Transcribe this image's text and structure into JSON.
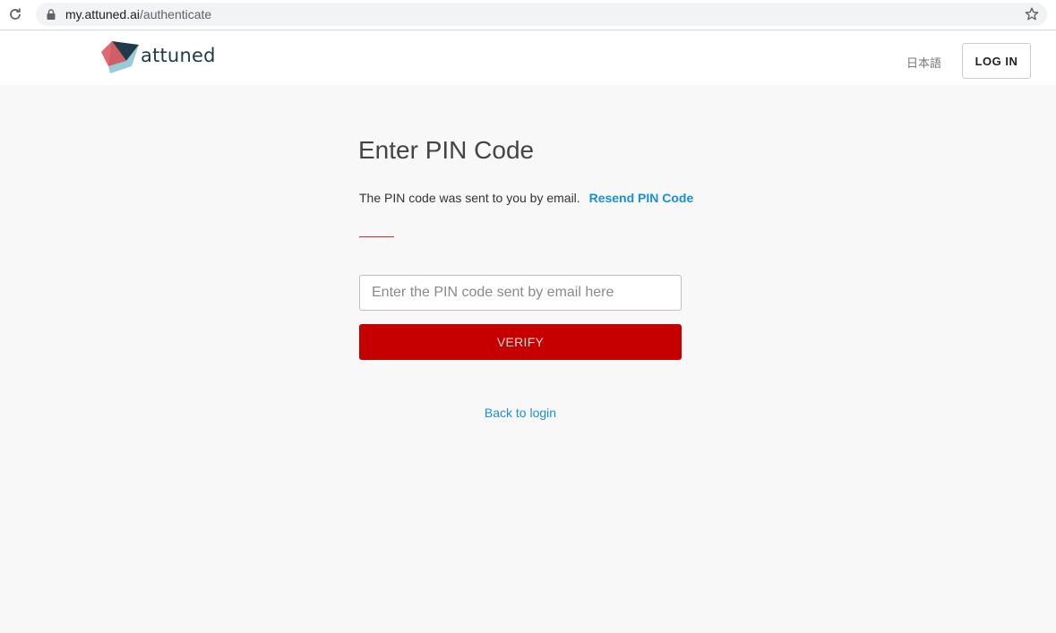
{
  "browser": {
    "url_host": "my.attuned.ai",
    "url_path": "/authenticate",
    "icons": [
      "reload-icon",
      "lock-icon",
      "star-icon"
    ]
  },
  "header": {
    "logo_text": "attuned",
    "language_link": "日本語",
    "login_label": "LOG IN"
  },
  "main": {
    "title": "Enter PIN Code",
    "info_text": "The PIN code was sent to you by email.",
    "resend_label": "Resend PIN Code",
    "pin_input": {
      "placeholder": "Enter the PIN code sent by email here",
      "value": ""
    },
    "verify_label": "VERIFY",
    "back_label": "Back to login"
  },
  "colors": {
    "accent_red": "#c60000",
    "link_blue": "#1a8fd6",
    "background": "#f8f8f8"
  }
}
